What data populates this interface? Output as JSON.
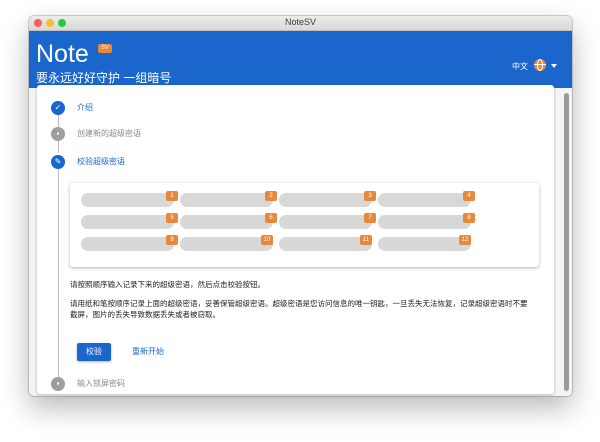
{
  "window": {
    "title": "NoteSV"
  },
  "appbar": {
    "app_name": "Note",
    "version_badge": "SV",
    "tagline": "要永远好好守护 一组暗号",
    "language": "中文",
    "globe_icon": "globe-icon",
    "colors": {
      "primary": "#1a66cc",
      "accent": "#e8883a"
    }
  },
  "steps": [
    {
      "label": "介绍",
      "state": "complete",
      "icon": "check-icon"
    },
    {
      "label": "创建新的超级密语",
      "state": "inactive",
      "icon": "folder-icon"
    },
    {
      "label": "校验超级密语",
      "state": "active",
      "icon": "pencil-icon"
    },
    {
      "label": "输入锁屏密码",
      "state": "inactive",
      "icon": "lock-icon"
    }
  ],
  "words": [
    "1",
    "2",
    "3",
    "4",
    "5",
    "6",
    "7",
    "8",
    "9",
    "10",
    "11",
    "12"
  ],
  "instructions": {
    "line1": "请按照顺序输入记录下来的超级密语，然后点击校验按钮。",
    "line2a": "请用纸和笔按顺序记录上面的超级密语，妥善保管超级密语。超级密语是您访问信息的唯一钥匙，一旦丢失无法恢复，记录超级密语时不要",
    "line2b": "截屏，图片的丢失导致数据丢失或者被窃取。"
  },
  "buttons": {
    "verify": "校验",
    "restart": "重新开始"
  }
}
